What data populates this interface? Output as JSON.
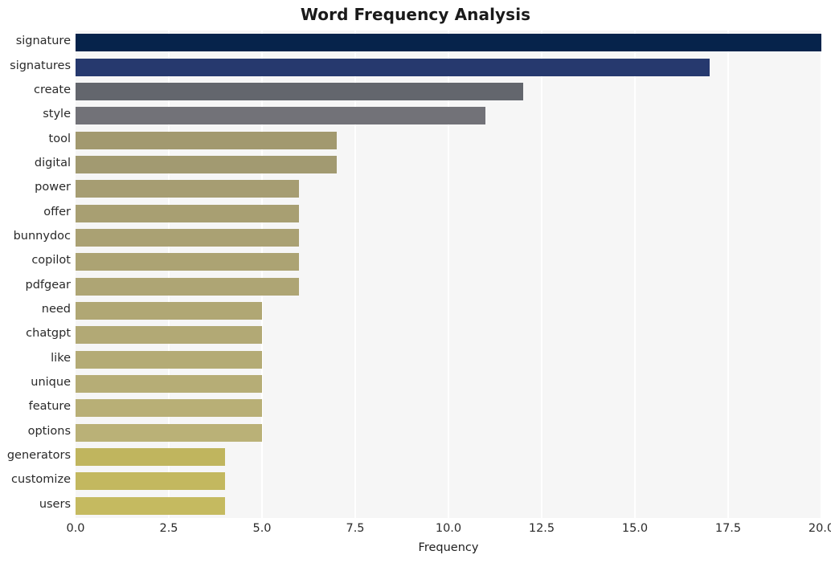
{
  "chart_data": {
    "type": "bar",
    "orientation": "horizontal",
    "title": "Word Frequency Analysis",
    "xlabel": "Frequency",
    "ylabel": "",
    "xlim": [
      0.0,
      20.0
    ],
    "xticks": [
      "0.0",
      "2.5",
      "5.0",
      "7.5",
      "10.0",
      "12.5",
      "15.0",
      "17.5",
      "20.0"
    ],
    "xtick_values": [
      0.0,
      2.5,
      5.0,
      7.5,
      10.0,
      12.5,
      15.0,
      17.5,
      20.0
    ],
    "grid": true,
    "grid_axis": "x",
    "legend": "none",
    "categories": [
      "signature",
      "signatures",
      "create",
      "style",
      "tool",
      "digital",
      "power",
      "offer",
      "bunnydoc",
      "copilot",
      "pdfgear",
      "need",
      "chatgpt",
      "like",
      "unique",
      "feature",
      "options",
      "generators",
      "customize",
      "users"
    ],
    "values": [
      20,
      17,
      12,
      11,
      7,
      7,
      6,
      6,
      6,
      6,
      6,
      5,
      5,
      5,
      5,
      5,
      5,
      4,
      4,
      4
    ],
    "bar_colors": [
      "#06234b",
      "#26396e",
      "#63666d",
      "#727278",
      "#a2996f",
      "#a29a71",
      "#a69d72",
      "#a89f72",
      "#aaa173",
      "#aca373",
      "#aea574",
      "#b0a774",
      "#b2a975",
      "#b4ab75",
      "#b6ad76",
      "#b8af76",
      "#bab177",
      "#c0b55e",
      "#c3b85f",
      "#c5ba60"
    ],
    "plot_background": "#f6f6f6",
    "gridline_color": "#ffffff",
    "text_color": "#2a2a2a",
    "title_color": "#1a1a1a"
  }
}
